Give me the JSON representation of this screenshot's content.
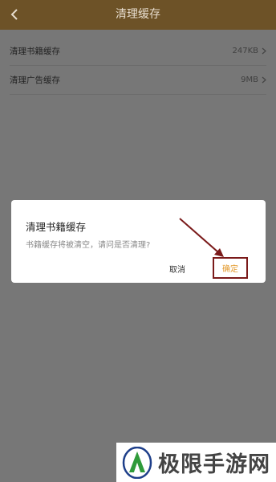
{
  "header": {
    "title": "清理缓存",
    "back_icon": "chevron-left-icon"
  },
  "items": [
    {
      "label": "清理书籍缓存",
      "value": "247KB"
    },
    {
      "label": "清理广告缓存",
      "value": "9MB"
    }
  ],
  "dialog": {
    "title": "清理书籍缓存",
    "message": "书籍缓存将被清空，请问是否清理?",
    "cancel_label": "取消",
    "confirm_label": "确定"
  },
  "watermark": {
    "text": "极限手游网"
  },
  "colors": {
    "header_bg": "#6d5227",
    "overlay_bg": "#777777",
    "confirm_text": "#e39a2d",
    "highlight": "#7a1a1a"
  }
}
